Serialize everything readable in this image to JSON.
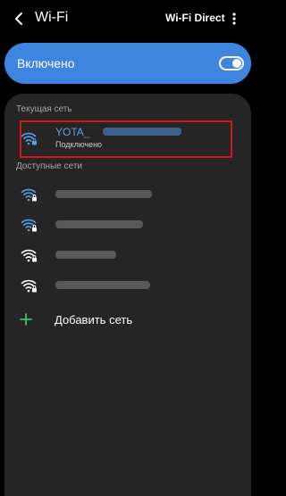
{
  "topbar": {
    "title": "Wi-Fi",
    "wifi_direct_label": "Wi-Fi Direct"
  },
  "toggle": {
    "label": "Включено",
    "state": "on"
  },
  "sections": {
    "current": "Текущая сеть",
    "available": "Доступные сети"
  },
  "current_network": {
    "name": "YOTA_",
    "status": "Подключено"
  },
  "available_networks": [
    {
      "name": "",
      "icon": "wifi-locked-icon"
    },
    {
      "name": "",
      "icon": "wifi-locked-icon"
    },
    {
      "name": "",
      "icon": "wifi-locked-icon"
    },
    {
      "name": "",
      "icon": "wifi-locked-icon"
    }
  ],
  "add_network": {
    "label": "Добавить сеть"
  },
  "colors": {
    "accent": "#3e85e0",
    "highlight": "#d6141c",
    "panel": "#252525",
    "background": "#000000"
  }
}
